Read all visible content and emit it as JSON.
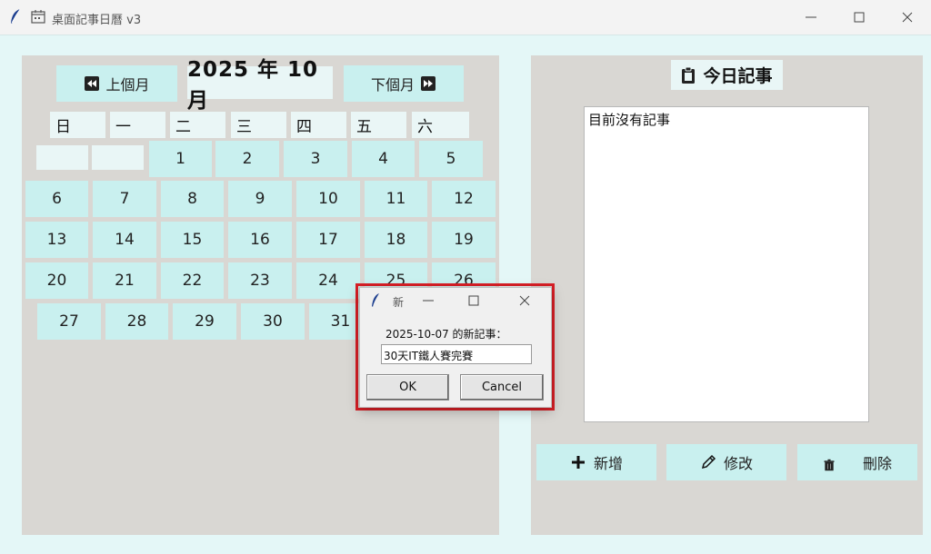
{
  "window": {
    "title": "桌面記事日曆 v3"
  },
  "calendar": {
    "prev_label": "上個月",
    "next_label": "下個月",
    "month_label": "2025 年 10 月",
    "weekdays": [
      "日",
      "一",
      "二",
      "三",
      "四",
      "五",
      "六"
    ],
    "week1": [
      "1",
      "2",
      "3",
      "4",
      "5"
    ],
    "week2": [
      "6",
      "7",
      "8",
      "9",
      "10",
      "11",
      "12"
    ],
    "week3": [
      "13",
      "14",
      "15",
      "16",
      "17",
      "18",
      "19"
    ],
    "week4": [
      "20",
      "21",
      "22",
      "23",
      "24",
      "25",
      "26"
    ],
    "week5": [
      "27",
      "28",
      "29",
      "30",
      "31"
    ]
  },
  "today": {
    "title": "今日記事",
    "note_text": "目前沒有記事"
  },
  "actions": {
    "add_label": "新增",
    "edit_label": "修改",
    "delete_label": "刪除"
  },
  "dialog": {
    "title": "新",
    "prompt": "2025-10-07 的新記事：",
    "entry_value": "30天IT鐵人賽完賽",
    "ok_label": "OK",
    "cancel_label": "Cancel"
  },
  "colors": {
    "button_bg": "#c9f0ef",
    "client_bg": "#e4f7f7",
    "panel_bg": "#d9d7d3",
    "highlight_border": "#d81f26"
  }
}
